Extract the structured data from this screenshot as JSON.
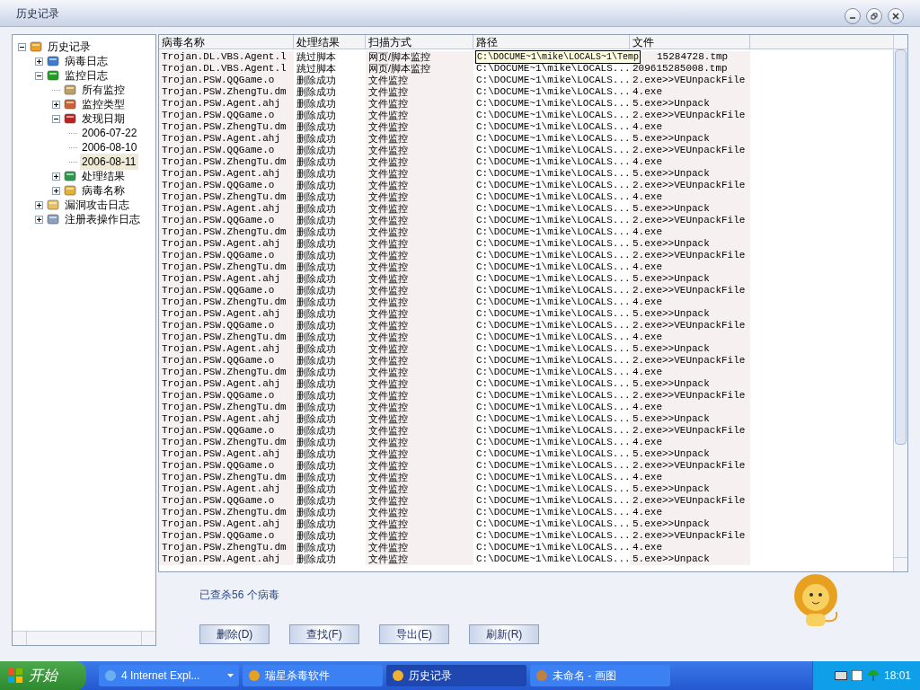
{
  "window": {
    "title": "历史记录"
  },
  "tree": [
    {
      "label": "历史记录",
      "kind": "branch",
      "expanded": true,
      "selected": false,
      "children": [
        {
          "label": "病毒日志",
          "kind": "branch",
          "expanded": false,
          "selected": false
        },
        {
          "label": "监控日志",
          "kind": "branch",
          "expanded": true,
          "selected": false,
          "children": [
            {
              "label": "所有监控",
              "kind": "leaf",
              "selected": false
            },
            {
              "label": "监控类型",
              "kind": "branch",
              "expanded": false,
              "selected": false
            },
            {
              "label": "发现日期",
              "kind": "branch",
              "expanded": true,
              "selected": false,
              "children": [
                {
                  "label": "2006-07-22",
                  "kind": "date",
                  "selected": false
                },
                {
                  "label": "2006-08-10",
                  "kind": "date",
                  "selected": false
                },
                {
                  "label": "2006-08-11",
                  "kind": "date",
                  "selected": true
                }
              ]
            },
            {
              "label": "处理结果",
              "kind": "branch",
              "expanded": false,
              "selected": false
            },
            {
              "label": "病毒名称",
              "kind": "branch",
              "expanded": false,
              "selected": false
            }
          ]
        },
        {
          "label": "漏洞攻击日志",
          "kind": "branch",
          "expanded": false,
          "selected": false
        },
        {
          "label": "注册表操作日志",
          "kind": "branch",
          "expanded": false,
          "selected": false
        }
      ]
    }
  ],
  "table": {
    "columns": [
      "病毒名称",
      "处理结果",
      "扫描方式",
      "路径",
      "文件"
    ],
    "rows": [
      {
        "name": "Trojan.DL.VBS.Agent.l",
        "result": "跳过脚本",
        "scan": "网页/脚本监控",
        "path": "C:\\DOCUME~1\\mike\\LOCALS~1\\Temp",
        "path_tooltip": true,
        "file": "15284728.tmp"
      },
      {
        "name": "Trojan.DL.VBS.Agent.l",
        "result": "跳过脚本",
        "scan": "网页/脚本监控",
        "path": "C:\\DOCUME~1\\mike\\LOCALS...",
        "path_tooltip": false,
        "file": "209615285008.tmp"
      },
      {
        "name": "Trojan.PSW.QQGame.o",
        "result": "删除成功",
        "scan": "文件监控",
        "path": "C:\\DOCUME~1\\mike\\LOCALS...",
        "path_tooltip": false,
        "file": "2.exe>>VEUnpackFile"
      },
      {
        "name": "Trojan.PSW.ZhengTu.dm",
        "result": "删除成功",
        "scan": "文件监控",
        "path": "C:\\DOCUME~1\\mike\\LOCALS...",
        "path_tooltip": false,
        "file": "4.exe"
      },
      {
        "name": "Trojan.PSW.Agent.ahj",
        "result": "删除成功",
        "scan": "文件监控",
        "path": "C:\\DOCUME~1\\mike\\LOCALS...",
        "path_tooltip": false,
        "file": "5.exe>>Unpack"
      },
      {
        "name": "Trojan.PSW.QQGame.o",
        "result": "删除成功",
        "scan": "文件监控",
        "path": "C:\\DOCUME~1\\mike\\LOCALS...",
        "path_tooltip": false,
        "file": "2.exe>>VEUnpackFile"
      },
      {
        "name": "Trojan.PSW.ZhengTu.dm",
        "result": "删除成功",
        "scan": "文件监控",
        "path": "C:\\DOCUME~1\\mike\\LOCALS...",
        "path_tooltip": false,
        "file": "4.exe"
      },
      {
        "name": "Trojan.PSW.Agent.ahj",
        "result": "删除成功",
        "scan": "文件监控",
        "path": "C:\\DOCUME~1\\mike\\LOCALS...",
        "path_tooltip": false,
        "file": "5.exe>>Unpack"
      },
      {
        "name": "Trojan.PSW.QQGame.o",
        "result": "删除成功",
        "scan": "文件监控",
        "path": "C:\\DOCUME~1\\mike\\LOCALS...",
        "path_tooltip": false,
        "file": "2.exe>>VEUnpackFile"
      },
      {
        "name": "Trojan.PSW.ZhengTu.dm",
        "result": "删除成功",
        "scan": "文件监控",
        "path": "C:\\DOCUME~1\\mike\\LOCALS...",
        "path_tooltip": false,
        "file": "4.exe"
      },
      {
        "name": "Trojan.PSW.Agent.ahj",
        "result": "删除成功",
        "scan": "文件监控",
        "path": "C:\\DOCUME~1\\mike\\LOCALS...",
        "path_tooltip": false,
        "file": "5.exe>>Unpack"
      },
      {
        "name": "Trojan.PSW.QQGame.o",
        "result": "删除成功",
        "scan": "文件监控",
        "path": "C:\\DOCUME~1\\mike\\LOCALS...",
        "path_tooltip": false,
        "file": "2.exe>>VEUnpackFile"
      },
      {
        "name": "Trojan.PSW.ZhengTu.dm",
        "result": "删除成功",
        "scan": "文件监控",
        "path": "C:\\DOCUME~1\\mike\\LOCALS...",
        "path_tooltip": false,
        "file": "4.exe"
      },
      {
        "name": "Trojan.PSW.Agent.ahj",
        "result": "删除成功",
        "scan": "文件监控",
        "path": "C:\\DOCUME~1\\mike\\LOCALS...",
        "path_tooltip": false,
        "file": "5.exe>>Unpack"
      },
      {
        "name": "Trojan.PSW.QQGame.o",
        "result": "删除成功",
        "scan": "文件监控",
        "path": "C:\\DOCUME~1\\mike\\LOCALS...",
        "path_tooltip": false,
        "file": "2.exe>>VEUnpackFile"
      },
      {
        "name": "Trojan.PSW.ZhengTu.dm",
        "result": "删除成功",
        "scan": "文件监控",
        "path": "C:\\DOCUME~1\\mike\\LOCALS...",
        "path_tooltip": false,
        "file": "4.exe"
      },
      {
        "name": "Trojan.PSW.Agent.ahj",
        "result": "删除成功",
        "scan": "文件监控",
        "path": "C:\\DOCUME~1\\mike\\LOCALS...",
        "path_tooltip": false,
        "file": "5.exe>>Unpack"
      },
      {
        "name": "Trojan.PSW.QQGame.o",
        "result": "删除成功",
        "scan": "文件监控",
        "path": "C:\\DOCUME~1\\mike\\LOCALS...",
        "path_tooltip": false,
        "file": "2.exe>>VEUnpackFile"
      },
      {
        "name": "Trojan.PSW.ZhengTu.dm",
        "result": "删除成功",
        "scan": "文件监控",
        "path": "C:\\DOCUME~1\\mike\\LOCALS...",
        "path_tooltip": false,
        "file": "4.exe"
      },
      {
        "name": "Trojan.PSW.Agent.ahj",
        "result": "删除成功",
        "scan": "文件监控",
        "path": "C:\\DOCUME~1\\mike\\LOCALS...",
        "path_tooltip": false,
        "file": "5.exe>>Unpack"
      },
      {
        "name": "Trojan.PSW.QQGame.o",
        "result": "删除成功",
        "scan": "文件监控",
        "path": "C:\\DOCUME~1\\mike\\LOCALS...",
        "path_tooltip": false,
        "file": "2.exe>>VEUnpackFile"
      },
      {
        "name": "Trojan.PSW.ZhengTu.dm",
        "result": "删除成功",
        "scan": "文件监控",
        "path": "C:\\DOCUME~1\\mike\\LOCALS...",
        "path_tooltip": false,
        "file": "4.exe"
      },
      {
        "name": "Trojan.PSW.Agent.ahj",
        "result": "删除成功",
        "scan": "文件监控",
        "path": "C:\\DOCUME~1\\mike\\LOCALS...",
        "path_tooltip": false,
        "file": "5.exe>>Unpack"
      },
      {
        "name": "Trojan.PSW.QQGame.o",
        "result": "删除成功",
        "scan": "文件监控",
        "path": "C:\\DOCUME~1\\mike\\LOCALS...",
        "path_tooltip": false,
        "file": "2.exe>>VEUnpackFile"
      },
      {
        "name": "Trojan.PSW.ZhengTu.dm",
        "result": "删除成功",
        "scan": "文件监控",
        "path": "C:\\DOCUME~1\\mike\\LOCALS...",
        "path_tooltip": false,
        "file": "4.exe"
      },
      {
        "name": "Trojan.PSW.Agent.ahj",
        "result": "删除成功",
        "scan": "文件监控",
        "path": "C:\\DOCUME~1\\mike\\LOCALS...",
        "path_tooltip": false,
        "file": "5.exe>>Unpack"
      },
      {
        "name": "Trojan.PSW.QQGame.o",
        "result": "删除成功",
        "scan": "文件监控",
        "path": "C:\\DOCUME~1\\mike\\LOCALS...",
        "path_tooltip": false,
        "file": "2.exe>>VEUnpackFile"
      },
      {
        "name": "Trojan.PSW.ZhengTu.dm",
        "result": "删除成功",
        "scan": "文件监控",
        "path": "C:\\DOCUME~1\\mike\\LOCALS...",
        "path_tooltip": false,
        "file": "4.exe"
      },
      {
        "name": "Trojan.PSW.Agent.ahj",
        "result": "删除成功",
        "scan": "文件监控",
        "path": "C:\\DOCUME~1\\mike\\LOCALS...",
        "path_tooltip": false,
        "file": "5.exe>>Unpack"
      },
      {
        "name": "Trojan.PSW.QQGame.o",
        "result": "删除成功",
        "scan": "文件监控",
        "path": "C:\\DOCUME~1\\mike\\LOCALS...",
        "path_tooltip": false,
        "file": "2.exe>>VEUnpackFile"
      },
      {
        "name": "Trojan.PSW.ZhengTu.dm",
        "result": "删除成功",
        "scan": "文件监控",
        "path": "C:\\DOCUME~1\\mike\\LOCALS...",
        "path_tooltip": false,
        "file": "4.exe"
      },
      {
        "name": "Trojan.PSW.Agent.ahj",
        "result": "删除成功",
        "scan": "文件监控",
        "path": "C:\\DOCUME~1\\mike\\LOCALS...",
        "path_tooltip": false,
        "file": "5.exe>>Unpack"
      },
      {
        "name": "Trojan.PSW.QQGame.o",
        "result": "删除成功",
        "scan": "文件监控",
        "path": "C:\\DOCUME~1\\mike\\LOCALS...",
        "path_tooltip": false,
        "file": "2.exe>>VEUnpackFile"
      },
      {
        "name": "Trojan.PSW.ZhengTu.dm",
        "result": "删除成功",
        "scan": "文件监控",
        "path": "C:\\DOCUME~1\\mike\\LOCALS...",
        "path_tooltip": false,
        "file": "4.exe"
      },
      {
        "name": "Trojan.PSW.Agent.ahj",
        "result": "删除成功",
        "scan": "文件监控",
        "path": "C:\\DOCUME~1\\mike\\LOCALS...",
        "path_tooltip": false,
        "file": "5.exe>>Unpack"
      },
      {
        "name": "Trojan.PSW.QQGame.o",
        "result": "删除成功",
        "scan": "文件监控",
        "path": "C:\\DOCUME~1\\mike\\LOCALS...",
        "path_tooltip": false,
        "file": "2.exe>>VEUnpackFile"
      },
      {
        "name": "Trojan.PSW.ZhengTu.dm",
        "result": "删除成功",
        "scan": "文件监控",
        "path": "C:\\DOCUME~1\\mike\\LOCALS...",
        "path_tooltip": false,
        "file": "4.exe"
      },
      {
        "name": "Trojan.PSW.Agent.ahj",
        "result": "删除成功",
        "scan": "文件监控",
        "path": "C:\\DOCUME~1\\mike\\LOCALS...",
        "path_tooltip": false,
        "file": "5.exe>>Unpack"
      },
      {
        "name": "Trojan.PSW.QQGame.o",
        "result": "删除成功",
        "scan": "文件监控",
        "path": "C:\\DOCUME~1\\mike\\LOCALS...",
        "path_tooltip": false,
        "file": "2.exe>>VEUnpackFile"
      },
      {
        "name": "Trojan.PSW.ZhengTu.dm",
        "result": "删除成功",
        "scan": "文件监控",
        "path": "C:\\DOCUME~1\\mike\\LOCALS...",
        "path_tooltip": false,
        "file": "4.exe"
      },
      {
        "name": "Trojan.PSW.Agent.ahj",
        "result": "删除成功",
        "scan": "文件监控",
        "path": "C:\\DOCUME~1\\mike\\LOCALS...",
        "path_tooltip": false,
        "file": "5.exe>>Unpack"
      },
      {
        "name": "Trojan.PSW.QQGame.o",
        "result": "删除成功",
        "scan": "文件监控",
        "path": "C:\\DOCUME~1\\mike\\LOCALS...",
        "path_tooltip": false,
        "file": "2.exe>>VEUnpackFile"
      },
      {
        "name": "Trojan.PSW.ZhengTu.dm",
        "result": "删除成功",
        "scan": "文件监控",
        "path": "C:\\DOCUME~1\\mike\\LOCALS...",
        "path_tooltip": false,
        "file": "4.exe"
      },
      {
        "name": "Trojan.PSW.Agent.ahj",
        "result": "删除成功",
        "scan": "文件监控",
        "path": "C:\\DOCUME~1\\mike\\LOCALS...",
        "path_tooltip": false,
        "file": "5.exe>>Unpack"
      }
    ]
  },
  "summary": "已查杀56 个病毒",
  "buttons": [
    "删除(D)",
    "查找(F)",
    "导出(E)",
    "刷新(R)"
  ],
  "taskbar": {
    "start": "开始",
    "tasks": [
      {
        "label": "4 Internet Expl...",
        "selected": false,
        "kind": "group"
      },
      {
        "label": "瑞星杀毒软件",
        "selected": false,
        "kind": "single"
      },
      {
        "label": "历史记录",
        "selected": true,
        "kind": "single"
      },
      {
        "label": "未命名 - 画图",
        "selected": false,
        "kind": "single"
      }
    ],
    "clock": "18:01"
  }
}
